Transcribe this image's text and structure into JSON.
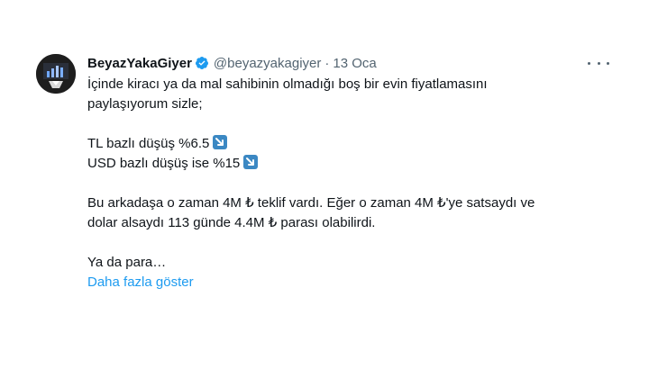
{
  "author": {
    "name": "BeyazYakaGiyer",
    "handle": "@beyazyakagiyer",
    "separator": "·",
    "date": "13 Oca"
  },
  "icons": {
    "avatar": "avatar-icon",
    "verified": "verified-badge-icon",
    "more": "more-options-icon",
    "arrow": "down-right-arrow-emoji-icon"
  },
  "colors": {
    "link": "#1d9bf0",
    "verified": "#1d9bf0",
    "muted": "#536471",
    "emoji_bg": "#3b88c3"
  },
  "tweet": {
    "line1": "İçinde kiracı ya da mal sahibinin olmadığı boş bir evin fiyatlamasını",
    "line2": "paylaşıyorum sizle;",
    "line3": "TL bazlı düşüş %6.5",
    "line4": "USD bazlı düşüş ise %15",
    "line5": "Bu arkadaşa o zaman 4M ₺ teklif vardı. Eğer o zaman 4M ₺'ye satsaydı ve",
    "line6": "dolar alsaydı 113 günde 4.4M ₺ parası olabilirdi.",
    "line7": "Ya da para…",
    "show_more": "Daha fazla göster"
  }
}
